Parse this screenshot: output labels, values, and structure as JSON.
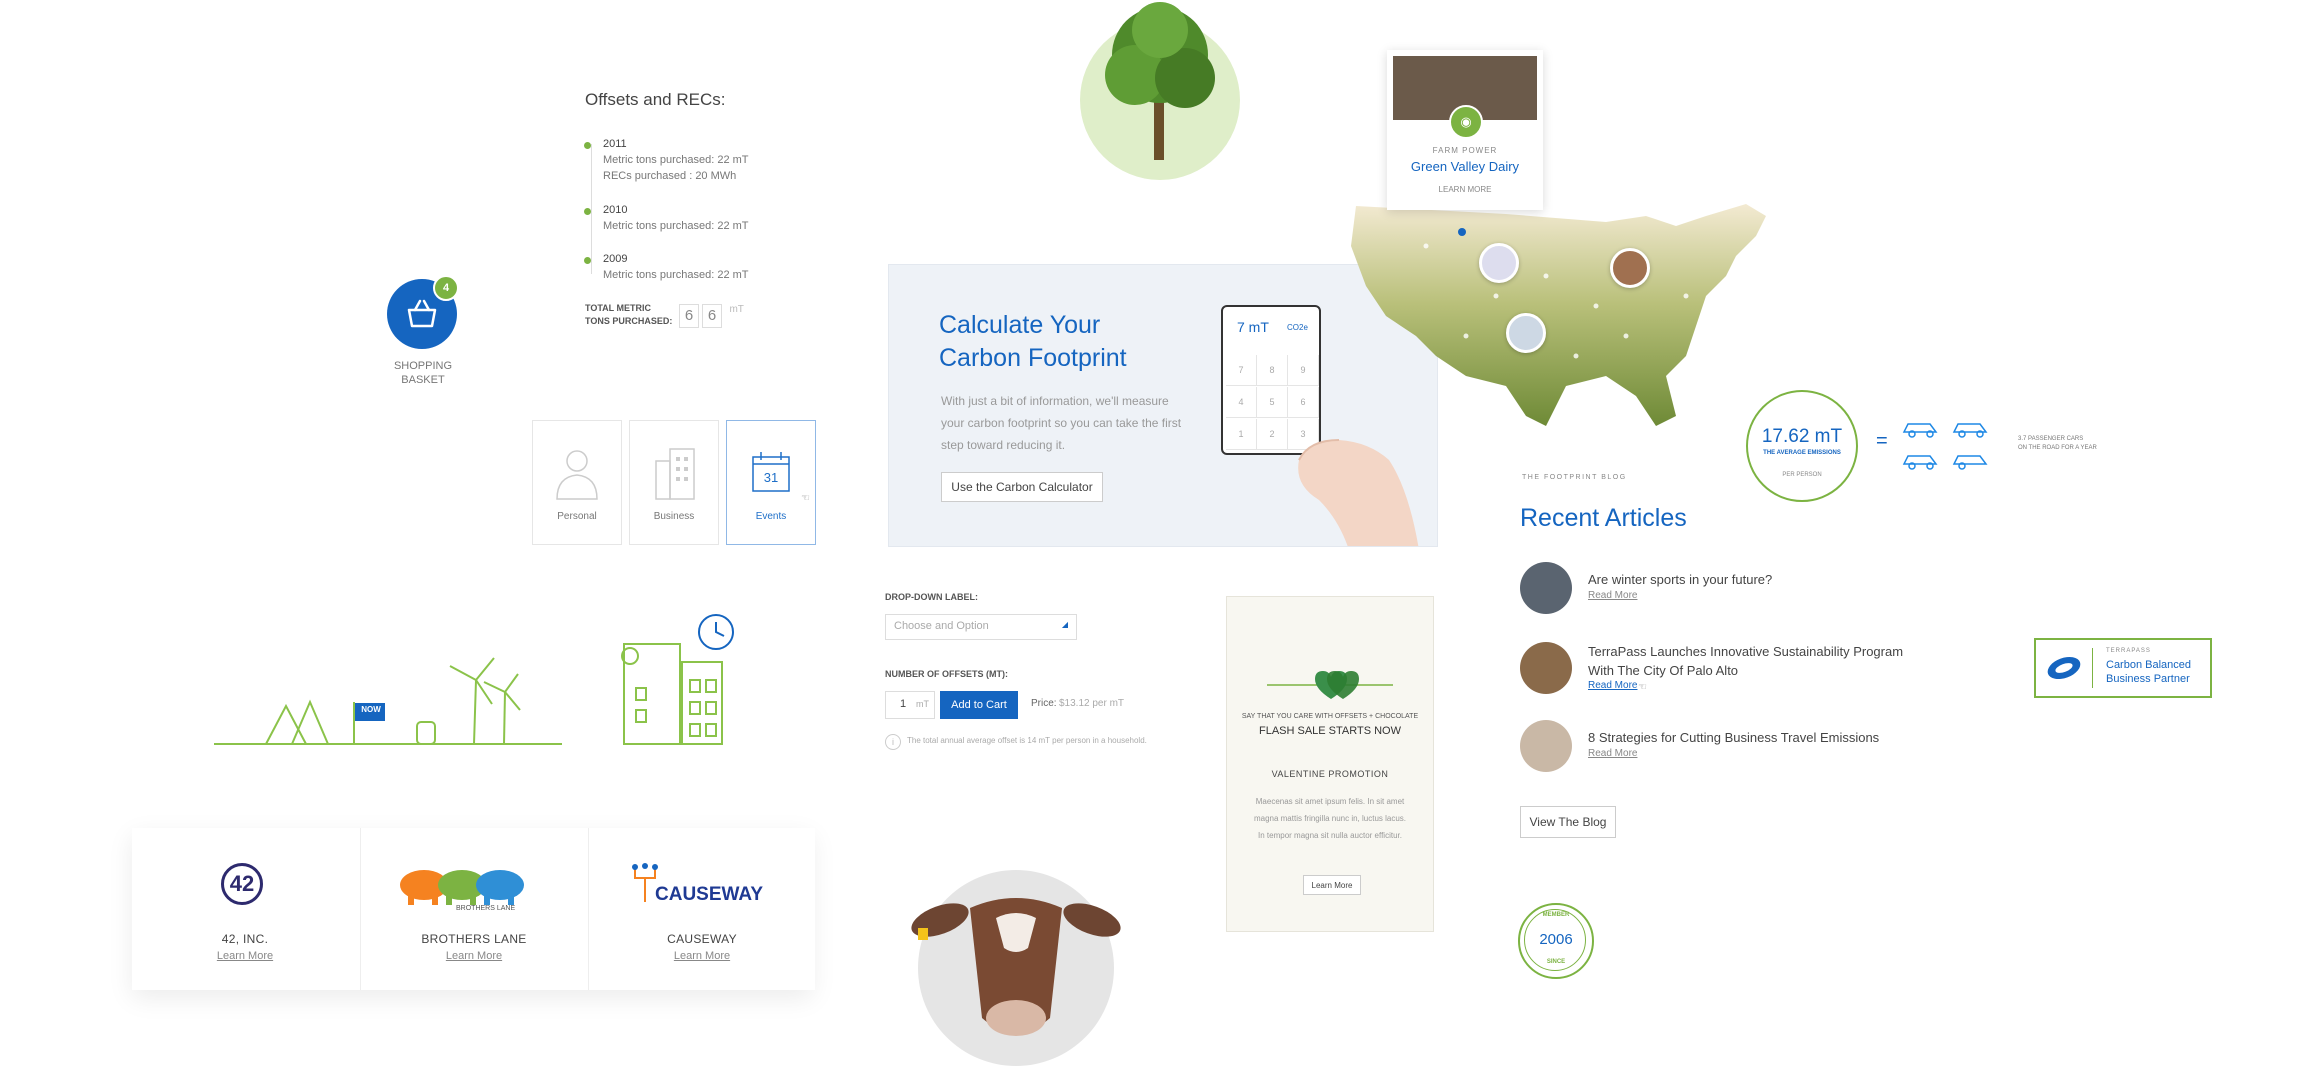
{
  "offsets": {
    "heading": "Offsets and RECs:",
    "entries": [
      {
        "year": "2011",
        "lines": [
          "Metric tons purchased: 22 mT",
          "RECs purchased : 20 MWh"
        ]
      },
      {
        "year": "2010",
        "lines": [
          "Metric tons purchased: 22 mT"
        ]
      },
      {
        "year": "2009",
        "lines": [
          "Metric tons purchased: 22 mT"
        ]
      }
    ],
    "total_label_1": "TOTAL METRIC",
    "total_label_2": "TONS PURCHASED:",
    "total_digits": [
      "6",
      "6"
    ],
    "total_unit": "mT"
  },
  "basket": {
    "badge": "4",
    "label_1": "SHOPPING",
    "label_2": "BASKET"
  },
  "segments": {
    "items": [
      {
        "label": "Personal",
        "icon": "person-icon"
      },
      {
        "label": "Business",
        "icon": "building-icon"
      },
      {
        "label": "Events",
        "icon": "calendar-icon"
      }
    ],
    "calendar_day": "31"
  },
  "illustration": {
    "flag_text": "NOW"
  },
  "partners": [
    {
      "name": "42, INC.",
      "link": "Learn More",
      "logo_text": "42"
    },
    {
      "name": "BROTHERS LANE",
      "link": "Learn More",
      "logo_text": "BROTHERS LANE"
    },
    {
      "name": "CAUSEWAY",
      "link": "Learn More",
      "logo_text": "CAUSEWAY"
    }
  ],
  "calculator": {
    "title_1": "Calculate Your",
    "title_2": "Carbon Footprint",
    "body": "With just a bit of information, we'll measure your carbon footprint so you can take the first step toward reducing it.",
    "button": "Use the Carbon Calculator",
    "display_value": "7 mT",
    "display_unit": "CO2e",
    "keys": [
      "7",
      "8",
      "9",
      "4",
      "5",
      "6",
      "1",
      "2",
      "3"
    ]
  },
  "order_form": {
    "dropdown_label": "DROP-DOWN LABEL:",
    "dropdown_placeholder": "Choose and Option",
    "offsets_label": "NUMBER OF OFFSETS (MT):",
    "qty": "1",
    "qty_unit": "mT",
    "add_button": "Add to Cart",
    "price_label": "Price:",
    "price_value": "$13.12 per mT",
    "note": "The total annual average offset is 14 mT per person in a household."
  },
  "promo": {
    "tagline": "SAY THAT YOU CARE WITH OFFSETS + CHOCOLATE",
    "headline": "FLASH SALE STARTS NOW",
    "title": "VALENTINE PROMOTION",
    "body": "Maecenas sit amet ipsum felis. In sit amet magna mattis fringilla nunc in, luctus lacus. In tempor magna sit nulla auctor efficitur.",
    "button": "Learn More"
  },
  "map": {
    "popup_kicker": "FARM POWER",
    "popup_title": "Green Valley Dairy",
    "popup_link": "LEARN MORE"
  },
  "emissions": {
    "value": "17.62 mT",
    "subtitle": "THE AVERAGE EMISSIONS",
    "per": "PER PERSON",
    "equals": "=",
    "cars_text_1": "3.7 PASSENGER CARS",
    "cars_text_2": "ON THE ROAD FOR A YEAR"
  },
  "blog": {
    "kicker": "THE FOOTPRINT BLOG",
    "heading": "Recent Articles",
    "articles": [
      {
        "title": "Are winter sports in your future?",
        "link": "Read More"
      },
      {
        "title": "TerraPass Launches Innovative Sustainability Program With The City Of Palo Alto",
        "link": "Read More"
      },
      {
        "title": "8 Strategies for Cutting Business Travel Emissions",
        "link": "Read More"
      }
    ],
    "button": "View The Blog"
  },
  "badge": {
    "top": "MEMBER",
    "year": "2006",
    "bottom": "SINCE"
  },
  "partner_badge": {
    "kicker": "TERRAPASS",
    "line_1": "Carbon Balanced",
    "line_2": "Business Partner"
  },
  "colors": {
    "brand_blue": "#1565c0",
    "brand_green": "#7cb342",
    "panel": "#eef2f7",
    "promo_bg": "#f8f7f1"
  }
}
